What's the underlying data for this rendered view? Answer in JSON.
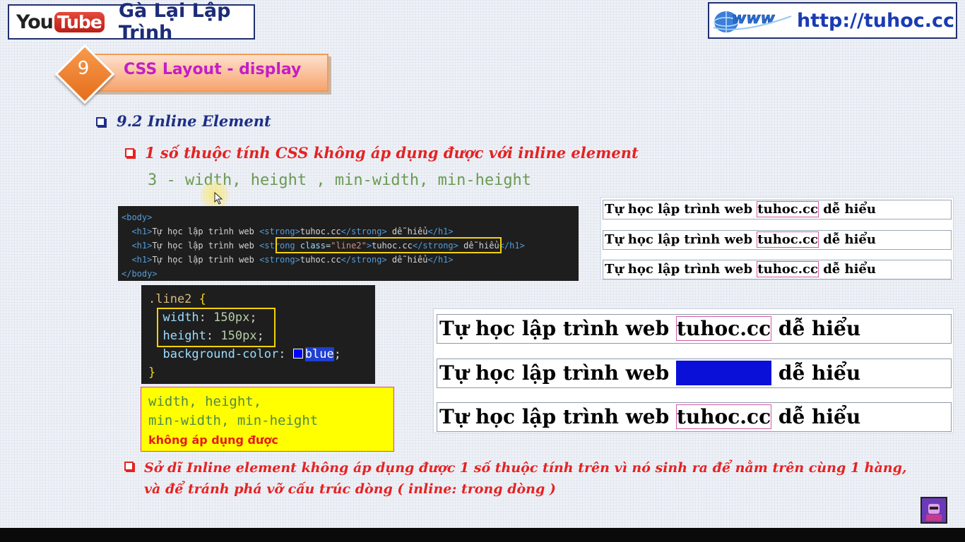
{
  "header": {
    "youtube_you": "You",
    "youtube_tube": "Tube",
    "channel_name": "Gà Lại Lập Trình",
    "site_url": "http://tuhoc.cc",
    "www_icon": "www-globe-icon"
  },
  "chapter": {
    "number": "9",
    "title": "CSS Layout - display"
  },
  "section": {
    "heading": "9.2 Inline Element",
    "sub_heading": "1 số thuộc tính CSS không áp dụng được với inline element",
    "properties_line": "3 - width, height , min-width, min-height"
  },
  "code_html": {
    "lines": [
      "<body>",
      "  <h1>Tự học lập trình web <strong>tuhoc.cc</strong> dễ hiểu</h1>",
      "  <h1>Tự học lập trình web <strong class=\"line2\">tuhoc.cc</strong> dễ hiểu</h1>",
      "  <h1>Tự học lập trình web <strong>tuhoc.cc</strong> dễ hiểu</h1>",
      "</body>"
    ]
  },
  "code_css": {
    "selector": ".line2",
    "width_prop": "width",
    "width_val": "150px",
    "height_prop": "height",
    "height_val": "150px",
    "bg_prop": "background-color",
    "bg_val": "blue",
    "swatch_color": "#0000ff"
  },
  "note": {
    "line1": "width, height,",
    "line2": "min-width, min-height",
    "line3": "không áp dụng được"
  },
  "result": {
    "text_before": "Tự học lập trình web ",
    "strong_text": "tuhoc.cc",
    "text_after": " dễ hiểu"
  },
  "footer_bullet": {
    "line1": "Sở dĩ Inline element không áp dụng được 1 số thuộc tính trên vì nó sinh ra để nằm trên cùng 1 hàng,",
    "line2": "và để tránh phá vỡ cấu trúc dòng ( inline: trong dòng )"
  },
  "colors": {
    "accent_blue": "#1e2f86",
    "accent_red": "#e52222",
    "banner_orange": "#f39a55",
    "banner_text": "#c41ec6"
  }
}
